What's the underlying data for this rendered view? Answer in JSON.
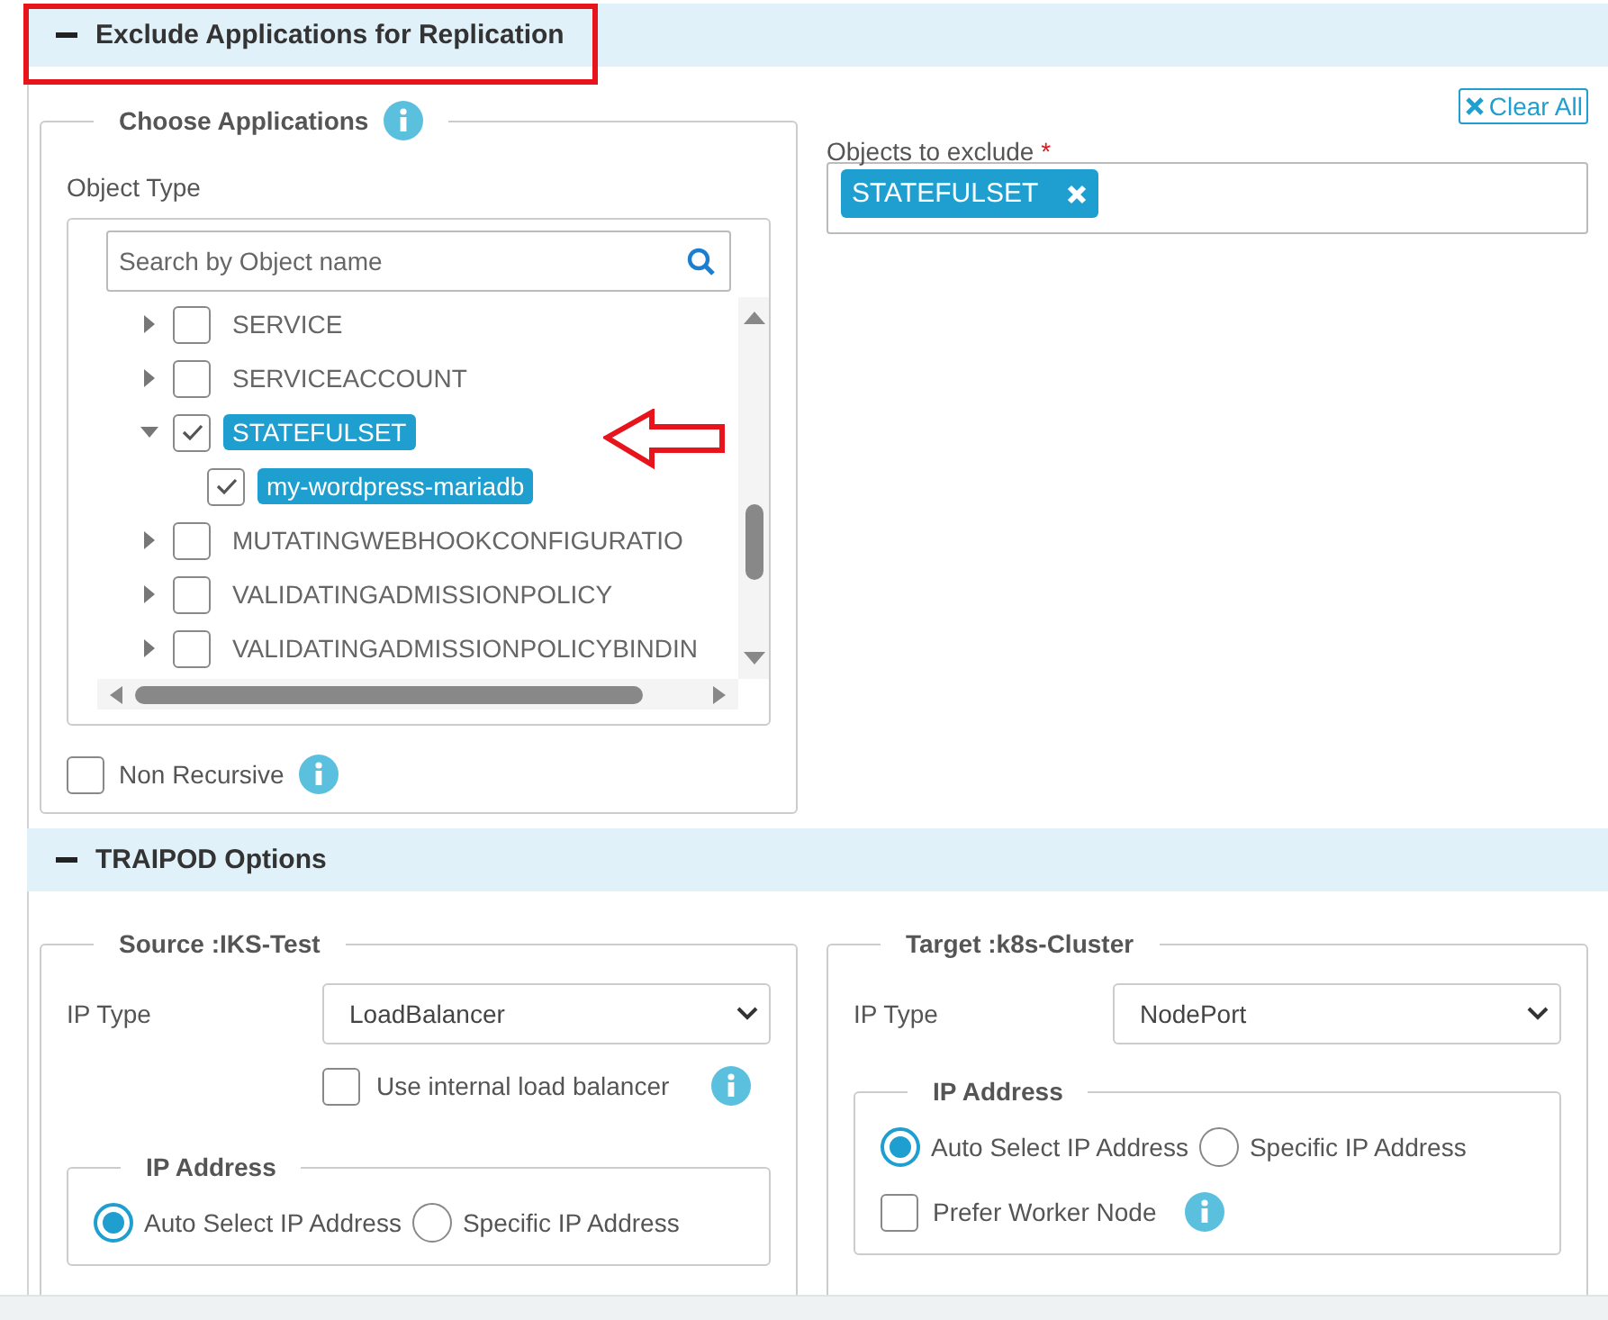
{
  "exclude_section": {
    "title": "Exclude Applications for Replication",
    "expanded": true,
    "highlighted": true,
    "choose": {
      "legend": "Choose Applications",
      "object_type_label": "Object Type",
      "search": {
        "placeholder": "Search by Object name"
      },
      "tree": [
        {
          "label": "SERVICE",
          "expanded": false,
          "checked": false,
          "selected": false,
          "pointed": false
        },
        {
          "label": "SERVICEACCOUNT",
          "expanded": false,
          "checked": false,
          "selected": false,
          "pointed": false
        },
        {
          "label": "STATEFULSET",
          "expanded": true,
          "checked": true,
          "selected": true,
          "pointed": true,
          "children": [
            {
              "label": "my-wordpress-mariadb",
              "checked": true,
              "selected": true
            }
          ]
        },
        {
          "label": "MUTATINGWEBHOOKCONFIGURATIO",
          "expanded": false,
          "checked": false,
          "selected": false,
          "pointed": false
        },
        {
          "label": "VALIDATINGADMISSIONPOLICY",
          "expanded": false,
          "checked": false,
          "selected": false,
          "pointed": false
        },
        {
          "label": "VALIDATINGADMISSIONPOLICYBINDIN",
          "expanded": false,
          "checked": false,
          "selected": false,
          "pointed": false
        }
      ],
      "non_recursive": {
        "label": "Non Recursive",
        "checked": false
      }
    },
    "objects": {
      "label": "Objects to exclude",
      "required_mark": "*",
      "clear_all": "Clear All",
      "tags": [
        {
          "label": "STATEFULSET"
        }
      ]
    }
  },
  "traipod_section": {
    "title": "TRAIPOD Options",
    "expanded": true,
    "source": {
      "legend": "Source :IKS-Test",
      "ip_type_label": "IP Type",
      "ip_type_value": "LoadBalancer",
      "internal_lb": {
        "label": "Use internal load balancer",
        "checked": false
      },
      "ip_address": {
        "legend": "IP Address",
        "options": [
          {
            "label": "Auto Select IP Address",
            "selected": true
          },
          {
            "label": "Specific IP Address",
            "selected": false
          }
        ]
      }
    },
    "target": {
      "legend": "Target :k8s-Cluster",
      "ip_type_label": "IP Type",
      "ip_type_value": "NodePort",
      "ip_address": {
        "legend": "IP Address",
        "options": [
          {
            "label": "Auto Select IP Address",
            "selected": true
          },
          {
            "label": "Specific IP Address",
            "selected": false
          }
        ]
      },
      "prefer_worker": {
        "label": "Prefer Worker Node",
        "checked": false
      }
    }
  }
}
